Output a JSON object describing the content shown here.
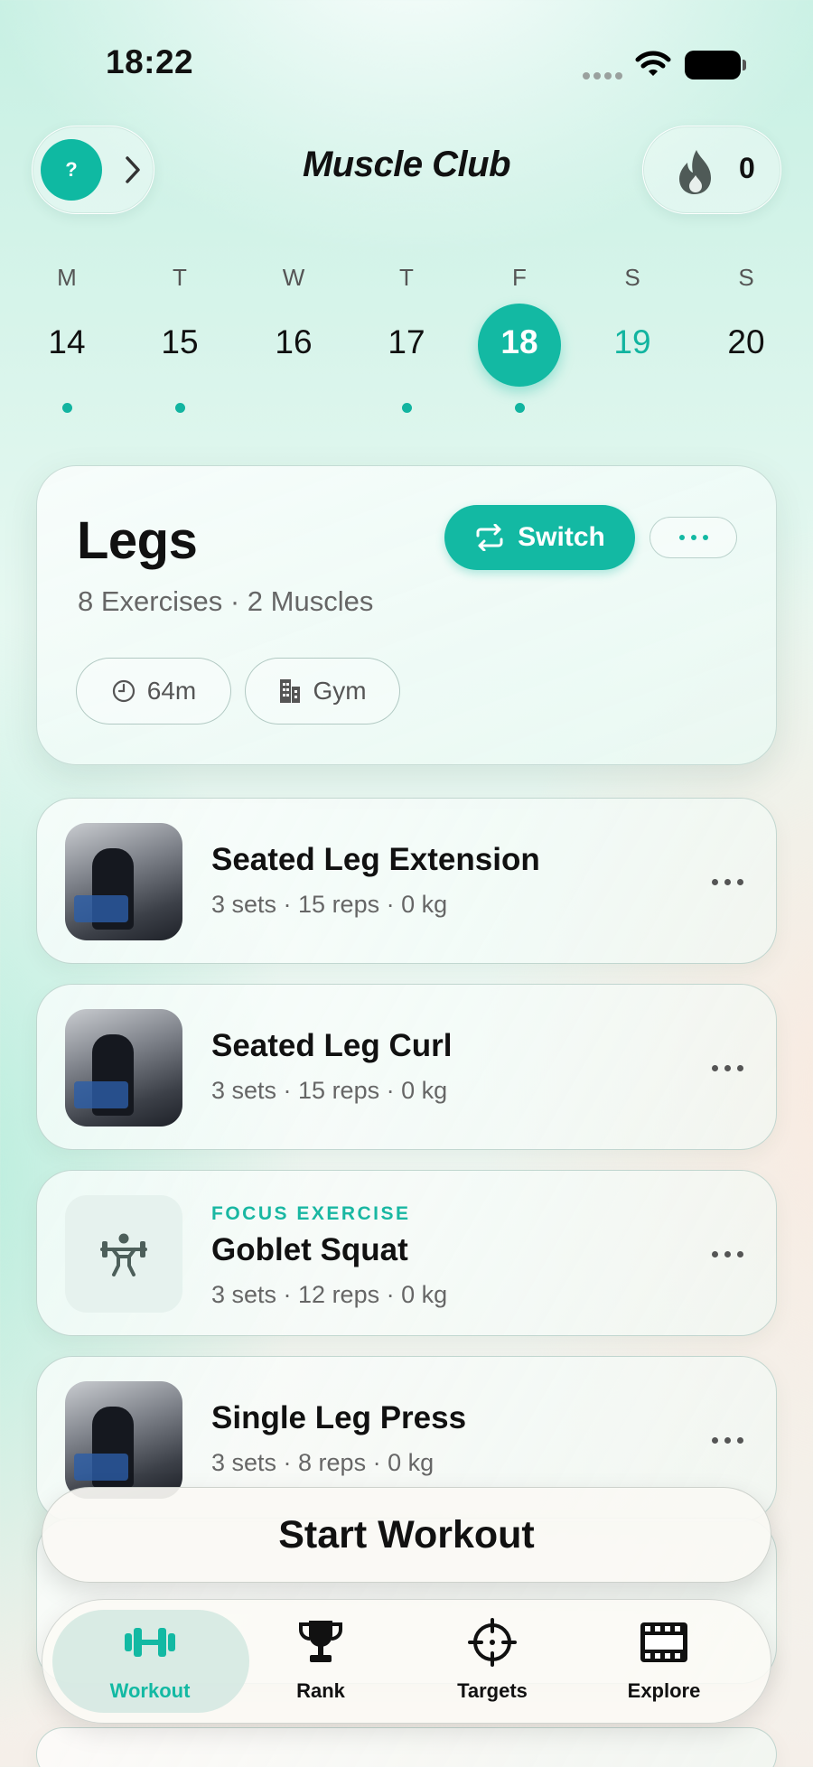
{
  "status_bar": {
    "time": "18:22"
  },
  "header": {
    "help_label": "?",
    "app_title": "Muscle Club",
    "streak_count": "0",
    "help_icon": "question-mark",
    "chevron_icon": "chevron-right",
    "streak_icon": "flame"
  },
  "week": {
    "days": [
      {
        "letter": "M",
        "number": "14",
        "has_dot": true,
        "state": "past"
      },
      {
        "letter": "T",
        "number": "15",
        "has_dot": true,
        "state": "past"
      },
      {
        "letter": "W",
        "number": "16",
        "has_dot": false,
        "state": "past"
      },
      {
        "letter": "T",
        "number": "17",
        "has_dot": true,
        "state": "past"
      },
      {
        "letter": "F",
        "number": "18",
        "has_dot": true,
        "state": "selected"
      },
      {
        "letter": "S",
        "number": "19",
        "has_dot": false,
        "state": "future-highlight"
      },
      {
        "letter": "S",
        "number": "20",
        "has_dot": false,
        "state": "future"
      }
    ]
  },
  "workout": {
    "title": "Legs",
    "subtitle": "8 Exercises · 2 Muscles",
    "switch_label": "Switch",
    "duration": "64m",
    "location": "Gym"
  },
  "exercises": [
    {
      "tag": "",
      "name": "Seated Leg Extension",
      "meta": "3 sets · 15 reps · 0 kg",
      "thumb": "photo"
    },
    {
      "tag": "",
      "name": "Seated Leg Curl",
      "meta": "3 sets · 15 reps · 0 kg",
      "thumb": "photo"
    },
    {
      "tag": "FOCUS EXERCISE",
      "name": "Goblet Squat",
      "meta": "3 sets · 12 reps · 0 kg",
      "thumb": "weightlifter-icon"
    },
    {
      "tag": "",
      "name": "Single Leg Press",
      "meta": "3 sets · 8 reps · 0 kg",
      "thumb": "photo"
    }
  ],
  "start_button": {
    "label": "Start Workout"
  },
  "tabbar": {
    "tabs": [
      {
        "label": "Workout",
        "icon": "dumbbell-icon",
        "active": true
      },
      {
        "label": "Rank",
        "icon": "trophy-icon",
        "active": false
      },
      {
        "label": "Targets",
        "icon": "crosshair-icon",
        "active": false
      },
      {
        "label": "Explore",
        "icon": "film-icon",
        "active": false
      }
    ]
  },
  "colors": {
    "accent": "#13b9a3",
    "text": "#111111",
    "muted": "#666666"
  }
}
